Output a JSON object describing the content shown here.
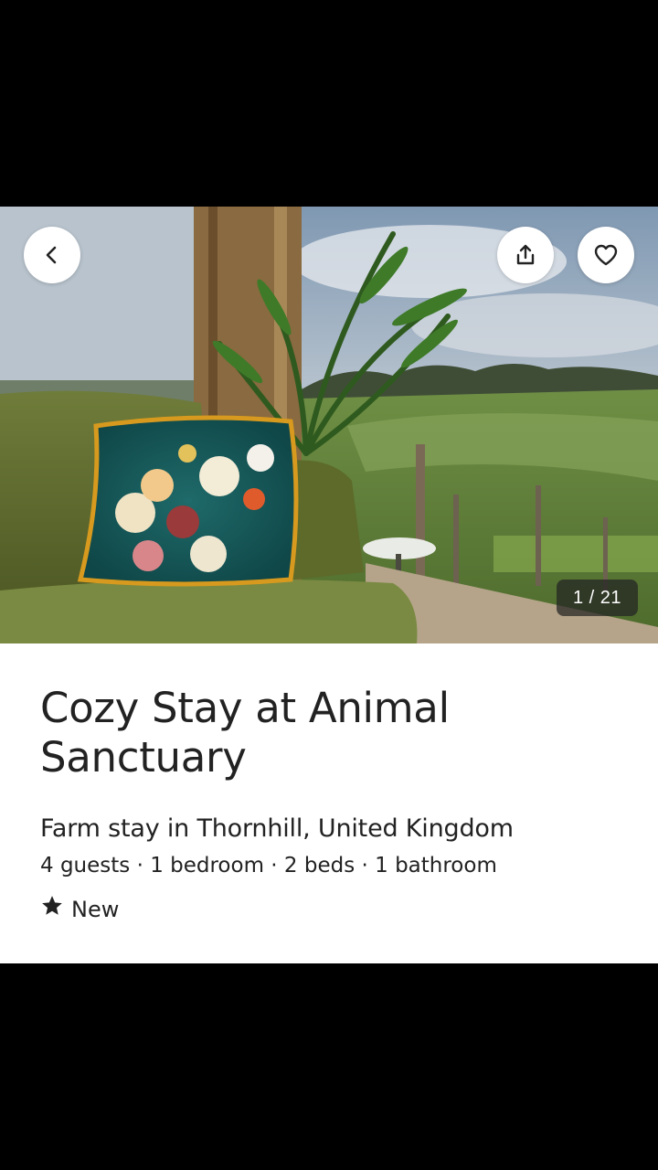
{
  "gallery": {
    "counter": "1 / 21",
    "back_icon": "chevron-left-icon",
    "share_icon": "share-icon",
    "favorite_icon": "heart-icon"
  },
  "listing": {
    "title": "Cozy Stay at Animal Sanctuary",
    "subtitle": "Farm stay in Thornhill, United Kingdom",
    "details": "4 guests · 1 bedroom · 2 beds · 1 bathroom",
    "rating_icon": "star-icon",
    "rating_label": "New"
  },
  "colors": {
    "text": "#222222",
    "background": "#ffffff"
  }
}
